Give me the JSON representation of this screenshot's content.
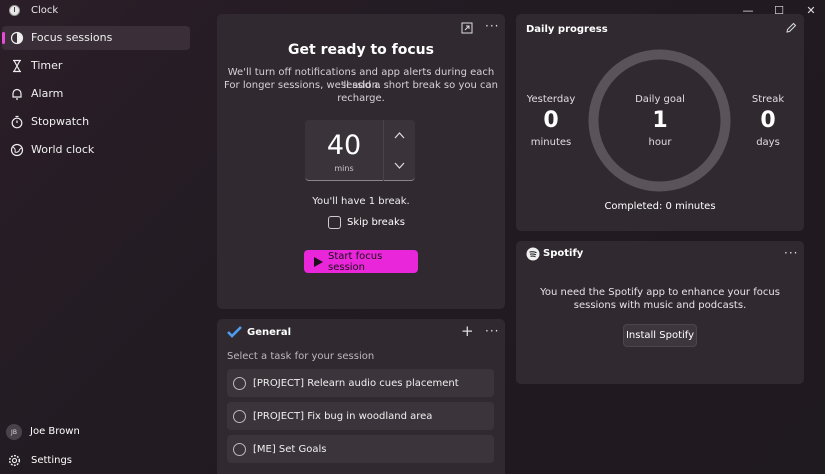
{
  "window": {
    "title": "Clock",
    "minimize": "—",
    "maximize": "☐",
    "close": "✕"
  },
  "sidebar": {
    "items": [
      {
        "label": "Focus sessions",
        "icon": "focus-icon",
        "active": true
      },
      {
        "label": "Timer",
        "icon": "hourglass-icon",
        "active": false
      },
      {
        "label": "Alarm",
        "icon": "bell-icon",
        "active": false
      },
      {
        "label": "Stopwatch",
        "icon": "stopwatch-icon",
        "active": false
      },
      {
        "label": "World clock",
        "icon": "globe-icon",
        "active": false
      }
    ],
    "user": {
      "initials": "JB",
      "name": "Joe Brown"
    },
    "settings_label": "Settings"
  },
  "focus": {
    "heading": "Get ready to focus",
    "description_line1": "We'll turn off notifications and app alerts during each session.",
    "description_line2": "For longer sessions, we'll add a short break so you can",
    "description_line3": "recharge.",
    "minutes_value": "40",
    "minutes_unit": "mins",
    "break_text": "You'll have 1 break.",
    "skip_breaks_label": "Skip breaks",
    "start_label": "Start focus session"
  },
  "tasks": {
    "title": "General",
    "prompt": "Select a task for your session",
    "items": [
      "[PROJECT] Relearn audio cues placement",
      "[PROJECT] Fix bug in woodland area",
      "[ME] Set Goals"
    ]
  },
  "progress": {
    "title": "Daily progress",
    "yesterday": {
      "label": "Yesterday",
      "value": "0",
      "unit": "minutes"
    },
    "goal": {
      "label": "Daily goal",
      "value": "1",
      "unit": "hour"
    },
    "streak": {
      "label": "Streak",
      "value": "0",
      "unit": "days"
    },
    "completed": "Completed: 0 minutes"
  },
  "spotify": {
    "brand": "Spotify",
    "message_line1": "You need the Spotify app to enhance your focus",
    "message_line2": "sessions with music and podcasts.",
    "install_label": "Install Spotify"
  },
  "colors": {
    "accent": "#e926d9",
    "card": "#302a30",
    "background": "#221b22"
  }
}
